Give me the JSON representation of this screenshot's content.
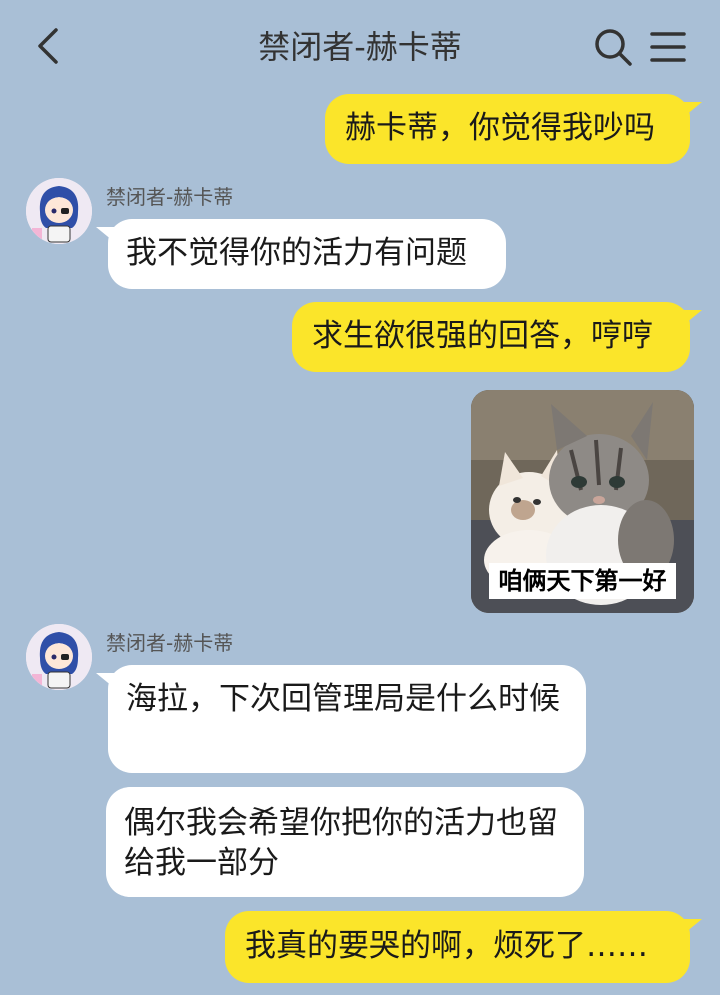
{
  "header": {
    "title": "禁闭者-赫卡蒂",
    "back_icon": "chevron-left-icon",
    "search_icon": "search-icon",
    "menu_icon": "hamburger-menu-icon"
  },
  "messages": [
    {
      "side": "me",
      "text": "赫卡蒂，你觉得我吵吗"
    },
    {
      "side": "them",
      "sender": "禁闭者-赫卡蒂",
      "text": "我不觉得你的活力有问题"
    },
    {
      "side": "me",
      "text": "求生欲很强的回答，哼哼"
    },
    {
      "side": "me",
      "type": "sticker",
      "caption": "咱俩天下第一好"
    },
    {
      "side": "them",
      "sender": "禁闭者-赫卡蒂",
      "text": "海拉，下次回管理局是什么时候"
    },
    {
      "side": "them",
      "text": "偶尔我会希望你把你的活力也留给我一部分"
    },
    {
      "side": "me",
      "text": "我真的要哭的啊，烦死了……"
    }
  ],
  "colors": {
    "background": "#a9bfd6",
    "my_bubble": "#fbe52a",
    "their_bubble": "#ffffff"
  }
}
